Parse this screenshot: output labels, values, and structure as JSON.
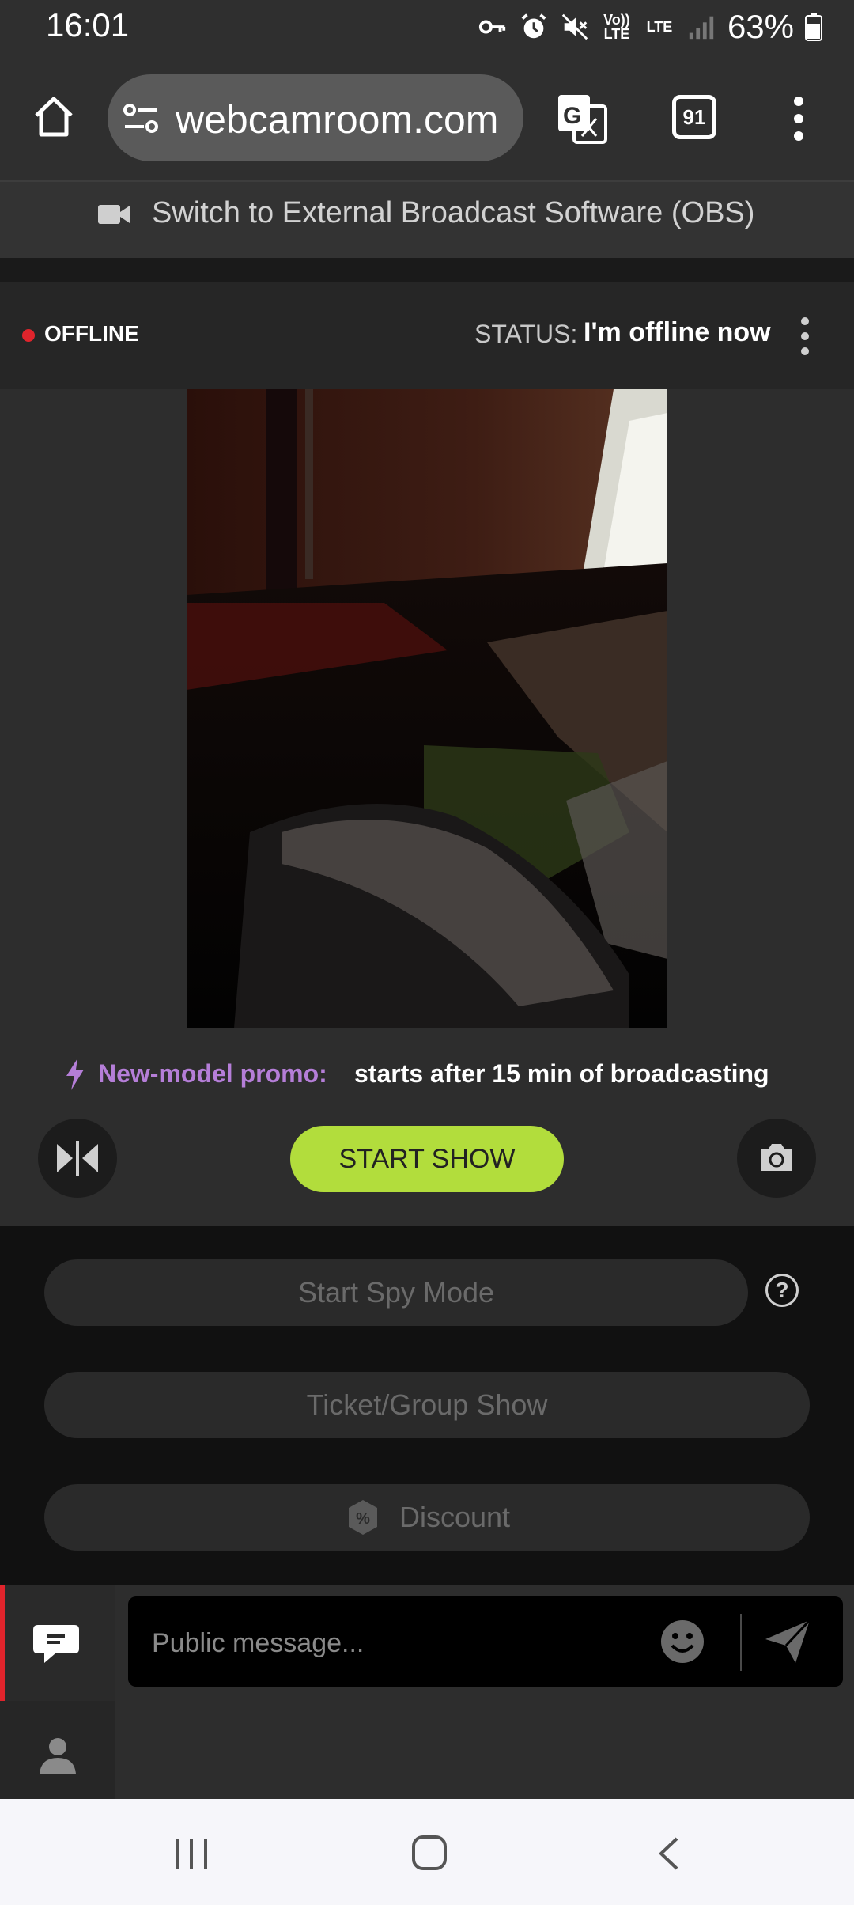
{
  "status_bar": {
    "time": "16:01",
    "volte": "Vo)) LTE",
    "lte": "LTE",
    "battery": "63%"
  },
  "browser": {
    "url": "webcamroom.com",
    "tab_count": "91"
  },
  "obs_bar": {
    "label": "Switch to External Broadcast Software (OBS)"
  },
  "broadcast": {
    "state": "OFFLINE",
    "status_label": "STATUS:",
    "status_value": "I'm offline now"
  },
  "promo": {
    "label": "New-model promo:",
    "text": "starts after 15 min of broadcasting"
  },
  "controls": {
    "start_show": "START SHOW"
  },
  "options": {
    "spy_mode": "Start Spy Mode",
    "help": "?",
    "ticket_show": "Ticket/Group Show",
    "discount": "Discount",
    "discount_symbol": "%"
  },
  "chat": {
    "placeholder": "Public message..."
  },
  "colors": {
    "accent_green": "#b2dd3c",
    "offline_red": "#e0242c",
    "promo_purple": "#b57ed8"
  }
}
